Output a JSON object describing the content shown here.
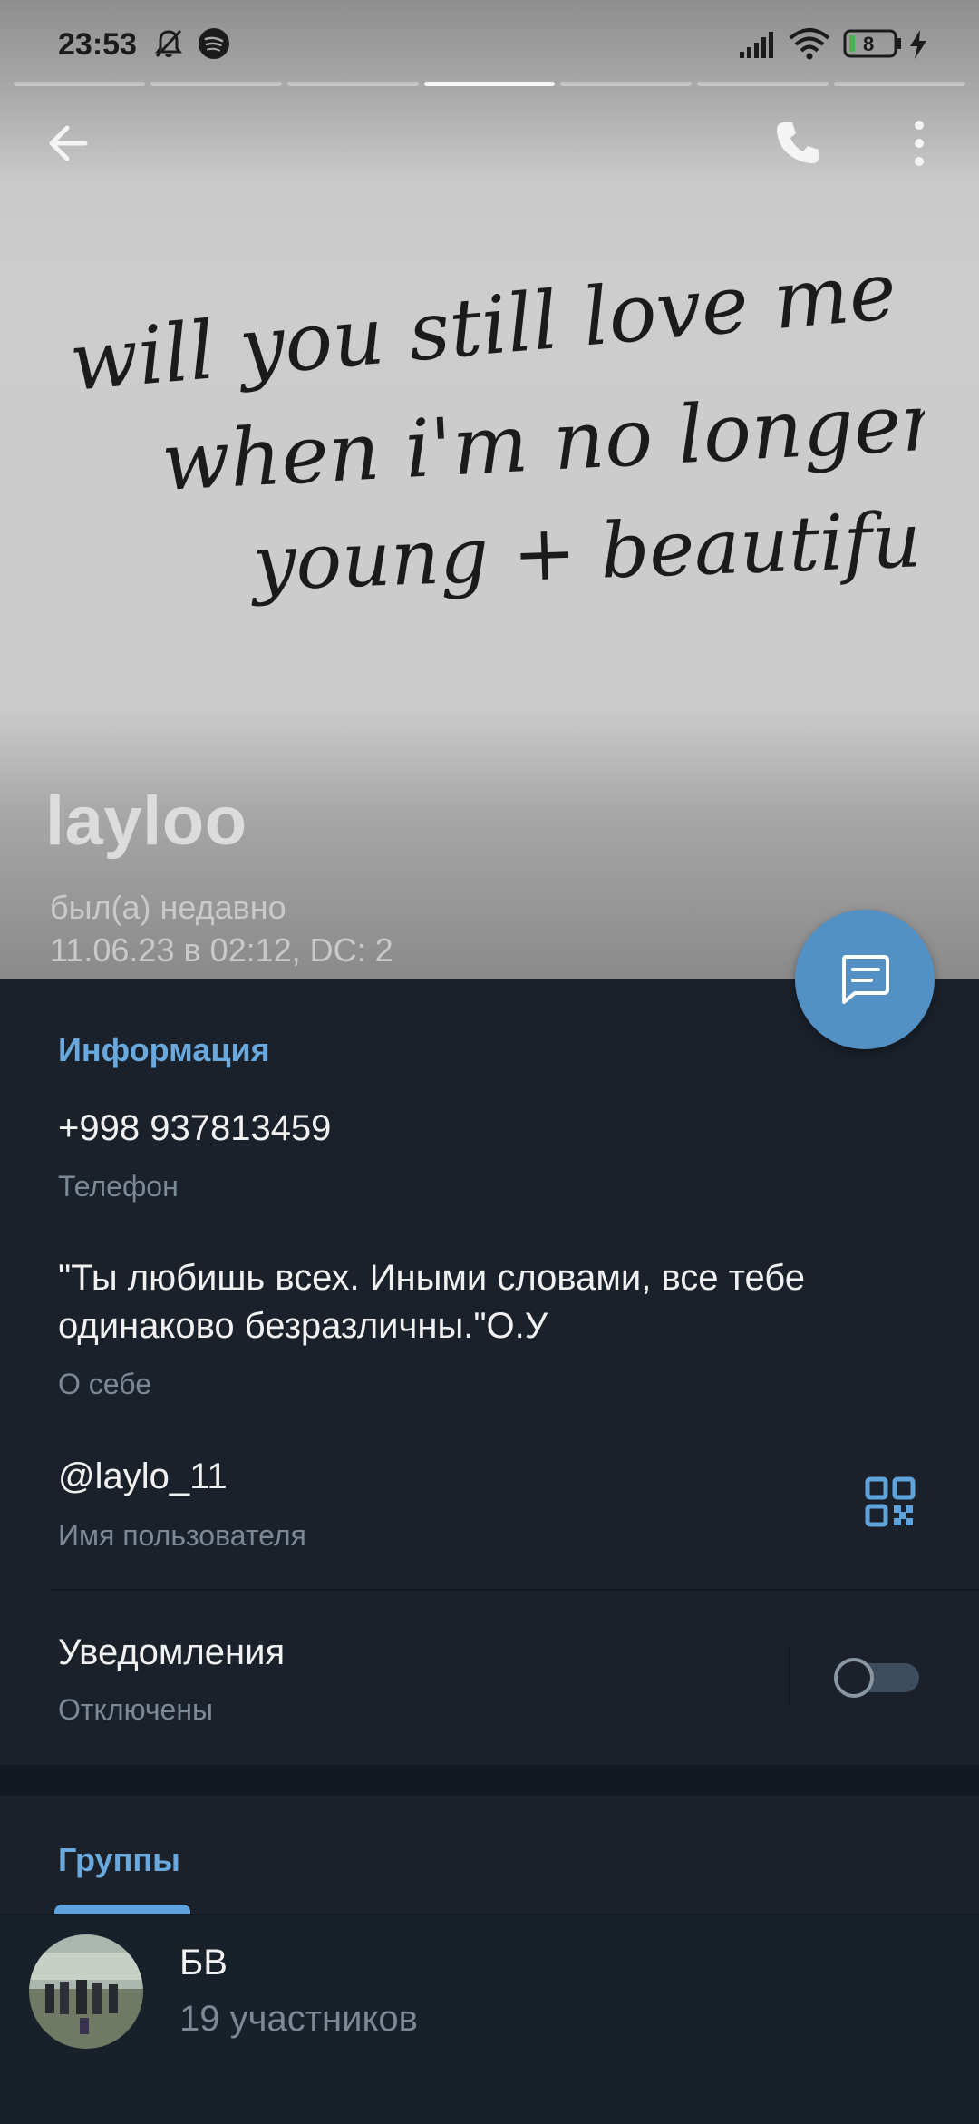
{
  "status_bar": {
    "time": "23:53",
    "battery_level": "8",
    "icons": [
      "mute-bell-icon",
      "spotify-icon",
      "signal-icon",
      "wifi-icon",
      "battery-icon",
      "charging-icon"
    ]
  },
  "stories": {
    "count": 7,
    "active_index": 3
  },
  "top_bar": {
    "icons": [
      "back-arrow-icon",
      "phone-icon",
      "more-vertical-icon"
    ]
  },
  "header_image": {
    "quote_lines": [
      "will you still love me",
      "when i'm no longer",
      "young + beautiful?"
    ]
  },
  "profile": {
    "name": "layloo",
    "last_seen": "был(а) недавно",
    "details": "11.06.23 в 02:12, DC: 2"
  },
  "info": {
    "section_title": "Информация",
    "phone": "+998 937813459",
    "phone_caption": "Телефон",
    "bio_line1": "\"Ты любишь всех. Иными словами, все тебе",
    "bio_line2": "одинаково безразличны.\"О.У",
    "bio_caption": "О себе",
    "username": "@laylo_11",
    "username_caption": "Имя пользователя",
    "notifications": "Уведомления",
    "notifications_state": "Отключены",
    "notifications_enabled": false
  },
  "groups": {
    "section_title": "Группы",
    "items": [
      {
        "name": "БВ",
        "members": "19 участников"
      }
    ]
  },
  "colors": {
    "accent": "#6aa9dd",
    "fab": "#5390c4",
    "panel_bg": "#1a212b",
    "text_primary": "#f1f1f1",
    "text_secondary": "#7c8894"
  }
}
